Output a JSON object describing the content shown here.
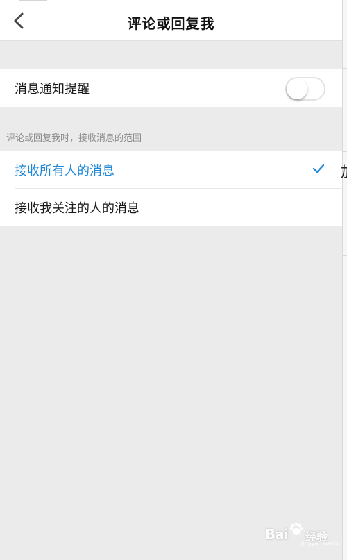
{
  "navbar": {
    "title": "评论或回复我",
    "back_icon": "chevron-left-icon"
  },
  "notification": {
    "label": "消息通知提醒",
    "toggle_on": false
  },
  "receive_section": {
    "caption": "评论或回复我时，接收消息的范围",
    "options": [
      {
        "label": "接收所有人的消息",
        "selected": true
      },
      {
        "label": "接收我关注的人的消息",
        "selected": false
      }
    ]
  },
  "side_edge": {
    "glyph": "加"
  },
  "watermark": {
    "brand": "Bai",
    "suffix": "经验",
    "url": "jingyan.baidu.com"
  },
  "colors": {
    "accent": "#1e87d6",
    "background": "#ebebeb",
    "surface": "#ffffff"
  }
}
